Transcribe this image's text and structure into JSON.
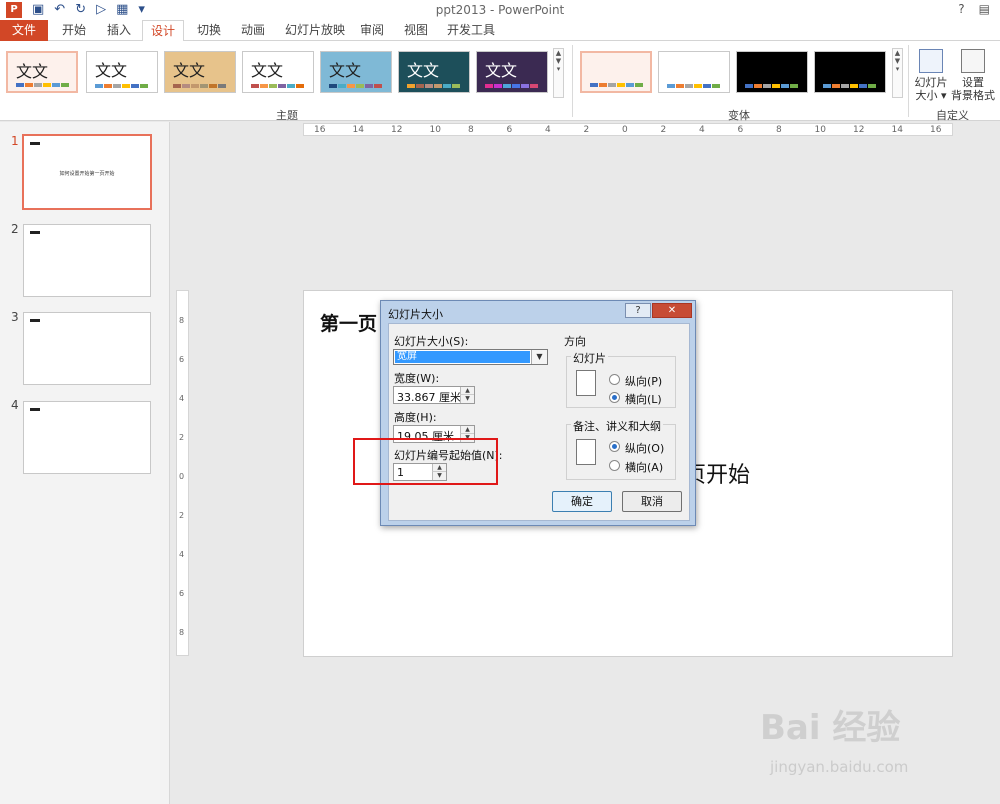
{
  "window": {
    "title": "ppt2013 - PowerPoint",
    "help": "?",
    "qat_app": "P"
  },
  "tabs": [
    "文件",
    "开始",
    "插入",
    "设计",
    "切换",
    "动画",
    "幻灯片放映",
    "审阅",
    "视图",
    "开发工具"
  ],
  "active_tab": "设计",
  "ribbon": {
    "theme_label": "文文",
    "group_themes": "主题",
    "group_variants": "变体",
    "group_customize": "自定义",
    "slide_size_btn": [
      "幻灯片",
      "大小 ▾"
    ],
    "format_bg_btn": [
      "设置",
      "背景格式"
    ]
  },
  "slides": [
    {
      "num": "1",
      "text": "如何设置开始第一页开始"
    },
    {
      "num": "2",
      "text": ""
    },
    {
      "num": "3",
      "text": ""
    },
    {
      "num": "4",
      "text": ""
    }
  ],
  "ruler": {
    "h": [
      "16",
      "14",
      "12",
      "10",
      "8",
      "6",
      "4",
      "2",
      "0",
      "2",
      "4",
      "6",
      "8",
      "10",
      "12",
      "14",
      "16"
    ],
    "v": [
      "8",
      "6",
      "4",
      "2",
      "0",
      "2",
      "4",
      "6",
      "8"
    ]
  },
  "slide": {
    "title": "第一页",
    "body": "页开始"
  },
  "dialog": {
    "title": "幻灯片大小",
    "help": "?",
    "close": "✕",
    "size_label": "幻灯片大小(S):",
    "size_value": "宽屏",
    "width_label": "宽度(W):",
    "width_value": "33.867 厘米",
    "height_label": "高度(H):",
    "height_value": "19.05 厘米",
    "number_label": "幻灯片编号起始值(N):",
    "number_value": "1",
    "orientation_label": "方向",
    "slides_group": "幻灯片",
    "slides_portrait": "纵向(P)",
    "slides_landscape": "横向(L)",
    "notes_group": "备注、讲义和大纲",
    "notes_portrait": "纵向(O)",
    "notes_landscape": "横向(A)",
    "ok": "确定",
    "cancel": "取消"
  },
  "colors": {
    "accent": "#d24726",
    "highlight": "#e01818"
  },
  "watermark": {
    "brand": "Bai 经验",
    "url": "jingyan.baidu.com"
  }
}
